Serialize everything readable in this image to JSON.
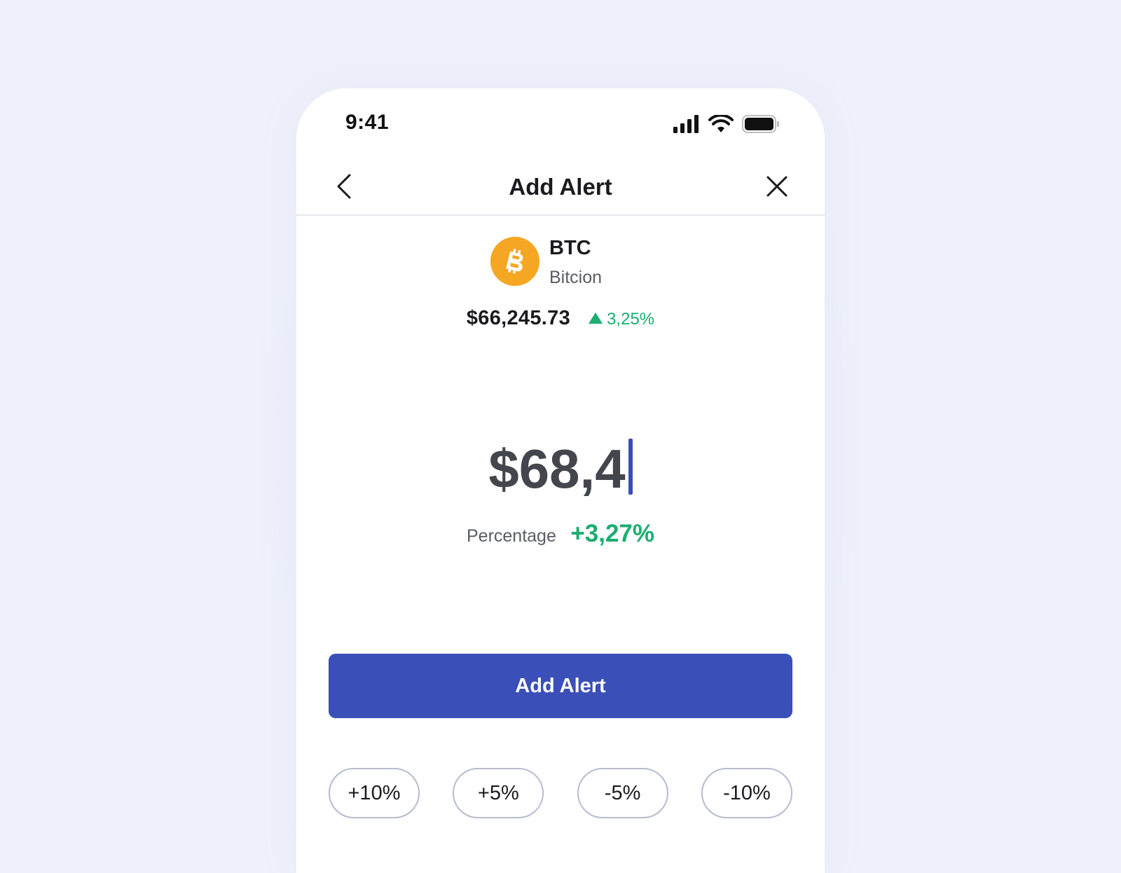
{
  "status_bar": {
    "time": "9:41"
  },
  "header": {
    "title": "Add Alert"
  },
  "coin": {
    "symbol": "BTC",
    "name": "Bitcion",
    "logo_color": "#f5a623"
  },
  "market": {
    "current_price": "$66,245.73",
    "change": "3,25%"
  },
  "alert_input": {
    "value": "$68,4"
  },
  "percentage": {
    "label": "Percentage",
    "value": "+3,27%"
  },
  "actions": {
    "add_label": "Add Alert"
  },
  "quick_changes": [
    {
      "label": "+10%"
    },
    {
      "label": "+5%"
    },
    {
      "label": "-5%"
    },
    {
      "label": "-10%"
    }
  ],
  "colors": {
    "primary": "#3b4fb8",
    "positive": "#1aae6f",
    "background": "#eef1fb"
  }
}
